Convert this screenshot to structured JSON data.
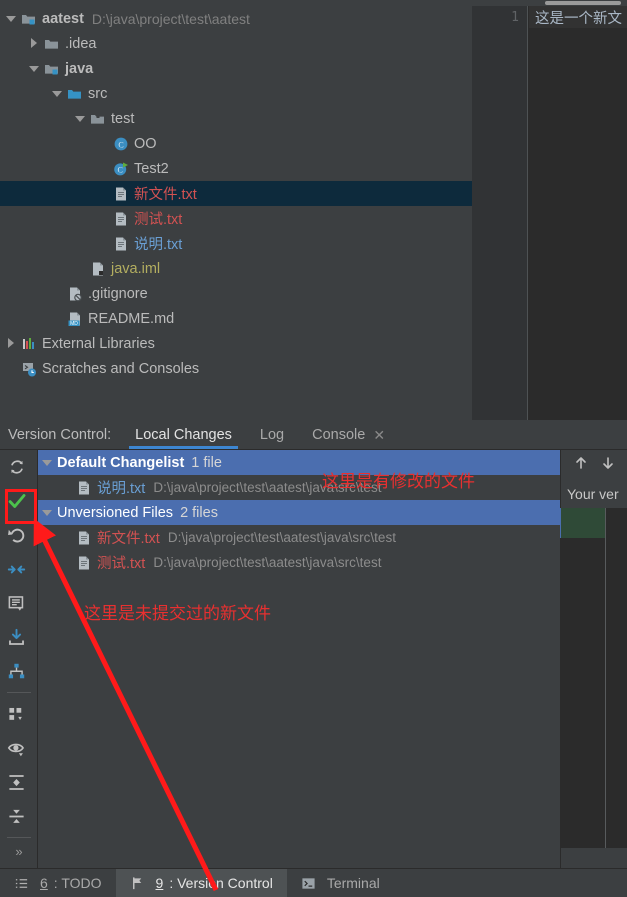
{
  "window": {
    "theme_bg": "#3c3f41",
    "accent": "#4b6eaf",
    "annotation_color": "#ff1a1a"
  },
  "project_tree": {
    "rows": [
      {
        "indent": 0,
        "arrow": "down",
        "icon": "module-folder-icon",
        "label": "aatest",
        "bold": true,
        "path": "D:\\java\\project\\test\\aatest",
        "color": "default",
        "selected": false
      },
      {
        "indent": 1,
        "arrow": "right",
        "icon": "folder-icon",
        "label": ".idea",
        "bold": false,
        "path": "",
        "color": "folder",
        "selected": false
      },
      {
        "indent": 1,
        "arrow": "down",
        "icon": "module-folder-icon",
        "label": "java",
        "bold": true,
        "path": "",
        "color": "default",
        "selected": false
      },
      {
        "indent": 2,
        "arrow": "down",
        "icon": "source-folder-icon",
        "label": "src",
        "bold": false,
        "path": "",
        "color": "default",
        "selected": false
      },
      {
        "indent": 3,
        "arrow": "down",
        "icon": "package-folder-icon",
        "label": "test",
        "bold": false,
        "path": "",
        "color": "default",
        "selected": false
      },
      {
        "indent": 4,
        "arrow": "none",
        "icon": "java-class-icon",
        "label": "OO",
        "bold": false,
        "path": "",
        "color": "default",
        "selected": false
      },
      {
        "indent": 4,
        "arrow": "none",
        "icon": "java-runnable-class-icon",
        "label": "Test2",
        "bold": false,
        "path": "",
        "color": "default",
        "selected": false
      },
      {
        "indent": 4,
        "arrow": "none",
        "icon": "text-file-icon",
        "label": "新文件.txt",
        "bold": false,
        "path": "",
        "color": "unversioned",
        "selected": true
      },
      {
        "indent": 4,
        "arrow": "none",
        "icon": "text-file-icon",
        "label": "测试.txt",
        "bold": false,
        "path": "",
        "color": "unversioned",
        "selected": false
      },
      {
        "indent": 4,
        "arrow": "none",
        "icon": "text-file-icon",
        "label": "说明.txt",
        "bold": false,
        "path": "",
        "color": "modified",
        "selected": false
      },
      {
        "indent": 3,
        "arrow": "none",
        "icon": "iml-file-icon",
        "label": "java.iml",
        "bold": false,
        "path": "",
        "color": "iml",
        "selected": false
      },
      {
        "indent": 2,
        "arrow": "none",
        "icon": "gitignore-file-icon",
        "label": ".gitignore",
        "bold": false,
        "path": "",
        "color": "default",
        "selected": false
      },
      {
        "indent": 2,
        "arrow": "none",
        "icon": "markdown-file-icon",
        "label": "README.md",
        "bold": false,
        "path": "",
        "color": "default",
        "selected": false
      },
      {
        "indent": 0,
        "arrow": "right",
        "icon": "libraries-icon",
        "label": "External Libraries",
        "bold": false,
        "path": "",
        "color": "default",
        "selected": false
      },
      {
        "indent": 0,
        "arrow": "none",
        "icon": "scratches-icon",
        "label": "Scratches and Consoles",
        "bold": false,
        "path": "",
        "color": "default",
        "selected": false
      }
    ]
  },
  "editor": {
    "line_number": "1",
    "line_text": "这是一个新文"
  },
  "version_control": {
    "title": "Version Control:",
    "tabs": [
      {
        "label": "Local Changes",
        "active": true,
        "closable": false
      },
      {
        "label": "Log",
        "active": false,
        "closable": false
      },
      {
        "label": "Console",
        "active": false,
        "closable": true,
        "close_glyph": "✕"
      }
    ],
    "toolbar": [
      {
        "name": "refresh-icon",
        "tooltip": "Refresh"
      },
      {
        "name": "commit-checkmark-icon",
        "tooltip": "Commit"
      },
      {
        "name": "rollback-icon",
        "tooltip": "Rollback"
      },
      {
        "name": "shelve-silently-icon",
        "tooltip": "Shelve Silently"
      },
      {
        "name": "show-diff-comment-icon",
        "tooltip": "Show Diff"
      },
      {
        "name": "update-project-icon",
        "tooltip": "Update Project"
      },
      {
        "name": "unshelve-icon",
        "tooltip": "Unshelve"
      },
      {
        "name": "group-by-icon",
        "tooltip": "Group By"
      },
      {
        "name": "preview-eye-icon",
        "tooltip": "Preview Diff"
      },
      {
        "name": "expand-all-icon",
        "tooltip": "Expand All"
      },
      {
        "name": "collapse-all-icon",
        "tooltip": "Collapse All"
      },
      {
        "name": "more-chevrons-icon",
        "label": "»"
      }
    ],
    "changes": [
      {
        "kind": "group",
        "label": "Default Changelist",
        "count": "1 file",
        "bold": true
      },
      {
        "kind": "file",
        "label": "说明.txt",
        "color": "modified",
        "path": "D:\\java\\project\\test\\aatest\\java\\src\\test"
      },
      {
        "kind": "group",
        "label": "Unversioned Files",
        "count": "2 files",
        "bold": false
      },
      {
        "kind": "file",
        "label": "新文件.txt",
        "color": "unversioned",
        "path": "D:\\java\\project\\test\\aatest\\java\\src\\test"
      },
      {
        "kind": "file",
        "label": "测试.txt",
        "color": "unversioned",
        "path": "D:\\java\\project\\test\\aatest\\java\\src\\test"
      }
    ],
    "preview": {
      "prev_change_icon": "arrow-up-icon",
      "next_change_icon": "arrow-down-icon",
      "label": "Your ver"
    }
  },
  "statusbar": {
    "items": [
      {
        "icon": "todo-list-icon",
        "mnemonic": "6",
        "label": ": TODO",
        "active": false
      },
      {
        "icon": "version-control-icon",
        "mnemonic": "9",
        "label": ": Version Control",
        "active": true
      },
      {
        "icon": "terminal-icon",
        "mnemonic": "",
        "label": "Terminal",
        "active": false
      }
    ]
  },
  "annotations": {
    "modified_note": "这里是有修改的文件",
    "unversioned_note": "这里是未提交过的新文件",
    "highlight_target": "commit-checkmark-icon"
  }
}
